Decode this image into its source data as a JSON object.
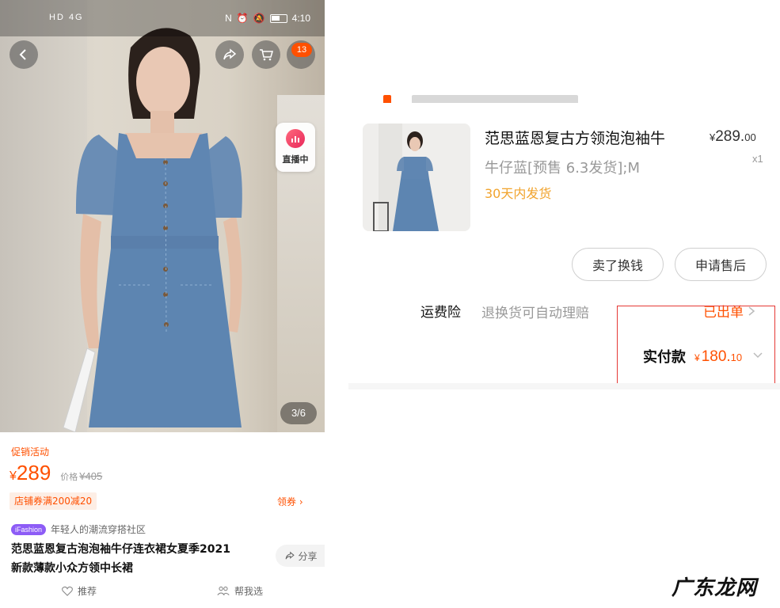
{
  "status_bar": {
    "signal_text": "HD 4G",
    "time": "4:10"
  },
  "left": {
    "cart_badge": "13",
    "live_label": "直播中",
    "image_index": "3/6",
    "promo_label": "促销活动",
    "price_symbol": "¥",
    "price": "289",
    "orig_price_label": "价格",
    "orig_price": "¥405",
    "coupon_tag": "店铺券满200减20",
    "coupon_link": "领券",
    "ifashion_tag": "iFashion",
    "ifashion_text": "年轻人的潮流穿搭社区",
    "title_line1": "范思蓝恩复古泡泡袖牛仔连衣裙女夏季2021",
    "title_line2": "新款薄款小众方领中长裙",
    "share_label": "分享",
    "tab_recommend": "推荐",
    "tab_help": "帮我选"
  },
  "right": {
    "product_title": "范思蓝恩复古方领泡泡袖牛",
    "price_symbol": "¥",
    "price_int": "289.",
    "price_dec": "00",
    "qty": "x1",
    "sku": "牛仔蓝[预售 6.3发货];M",
    "shipping_note": "30天内发货",
    "btn_sell": "卖了换钱",
    "btn_after_sale": "申请售后",
    "insurance_label": "运费险",
    "insurance_desc": "退换货可自动理赔",
    "insurance_status": "已出单",
    "paid_label": "实付款",
    "paid_symbol": "¥",
    "paid_int": "180.",
    "paid_dec": "10"
  },
  "watermark": "广东龙网",
  "colors": {
    "accent": "#ff5000",
    "shipping": "#f1a32c",
    "highlight": "#e53935",
    "ifashion": "#8d5cf6"
  }
}
